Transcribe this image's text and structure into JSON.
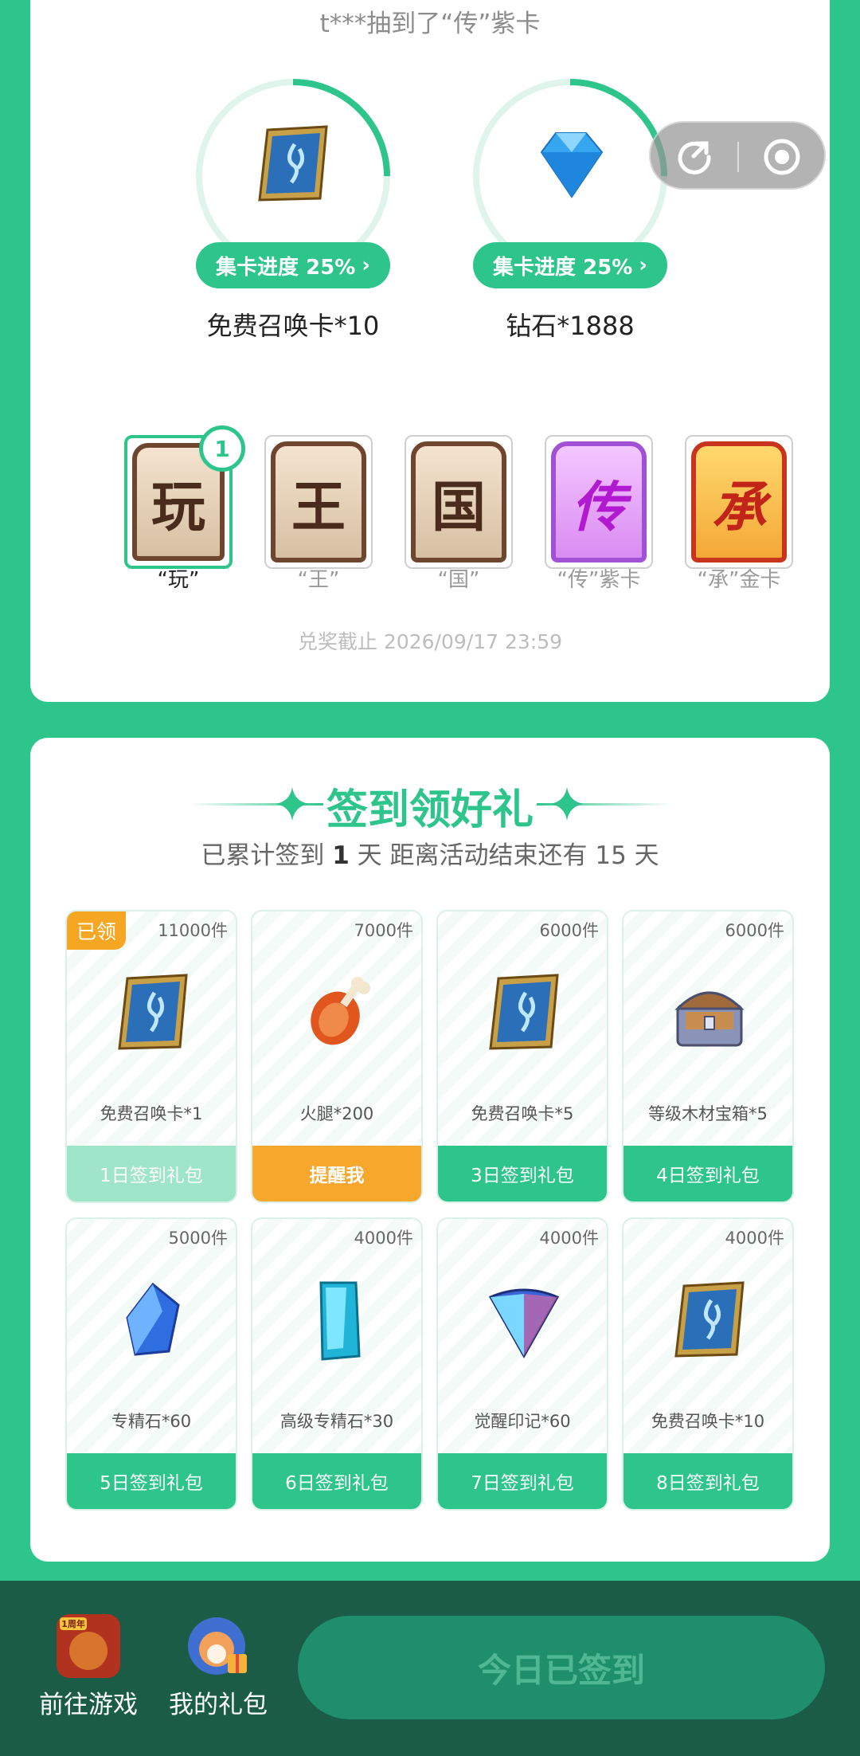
{
  "ticker": "t***抽到了“传”紫卡",
  "prizes": [
    {
      "progress_label": "集卡进度 25%",
      "progress": 0.25,
      "name": "免费召唤卡*10",
      "icon": "summon-card-icon"
    },
    {
      "progress_label": "集卡进度 25%",
      "progress": 0.25,
      "name": "钻石*1888",
      "icon": "diamond-icon"
    }
  ],
  "word_cards": [
    {
      "char": "玩",
      "label": "“玩”",
      "count": "1",
      "style": "brown",
      "owned": true
    },
    {
      "char": "王",
      "label": "“王”",
      "style": "brown",
      "owned": false
    },
    {
      "char": "国",
      "label": "“国”",
      "style": "brown",
      "owned": false
    },
    {
      "char": "传",
      "label": "“传”紫卡",
      "style": "purple",
      "owned": false
    },
    {
      "char": "承",
      "label": "“承”金卡",
      "style": "gold",
      "owned": false
    }
  ],
  "deadline": "兑奖截止 2026/09/17 23:59",
  "sign": {
    "title": "签到领好礼",
    "sub_prefix": "已累计签到",
    "days": "1",
    "sub_suffix": "天  距离活动结束还有 15 天",
    "gifts": [
      {
        "stock": "11000件",
        "name": "免费召唤卡*1",
        "button": "1日签到礼包",
        "state": "claimed",
        "claimed_tag": "已领",
        "icon": "summon-card-icon"
      },
      {
        "stock": "7000件",
        "name": "火腿*200",
        "button": "提醒我",
        "state": "remind",
        "icon": "ham-icon"
      },
      {
        "stock": "6000件",
        "name": "免费召唤卡*5",
        "button": "3日签到礼包",
        "state": "normal",
        "icon": "summon-card-icon"
      },
      {
        "stock": "6000件",
        "name": "等级木材宝箱*5",
        "button": "4日签到礼包",
        "state": "normal",
        "icon": "treasure-chest-icon"
      },
      {
        "stock": "5000件",
        "name": "专精石*60",
        "button": "5日签到礼包",
        "state": "normal",
        "icon": "blue-crystal-icon"
      },
      {
        "stock": "4000件",
        "name": "高级专精石*30",
        "button": "6日签到礼包",
        "state": "normal",
        "icon": "cyan-crystal-icon"
      },
      {
        "stock": "4000件",
        "name": "觉醒印记*60",
        "button": "7日签到礼包",
        "state": "normal",
        "icon": "awakening-mark-icon"
      },
      {
        "stock": "4000件",
        "name": "免费召唤卡*10",
        "button": "8日签到礼包",
        "state": "normal",
        "icon": "summon-card-icon"
      }
    ]
  },
  "bottom": {
    "go_game": "前往游戏",
    "game_badge": "1周年",
    "my_gifts": "我的礼包",
    "checkin": "今日已签到"
  },
  "colors": {
    "accent": "#2ec58c",
    "orange": "#f7a72c",
    "dark": "#1b5c47"
  }
}
